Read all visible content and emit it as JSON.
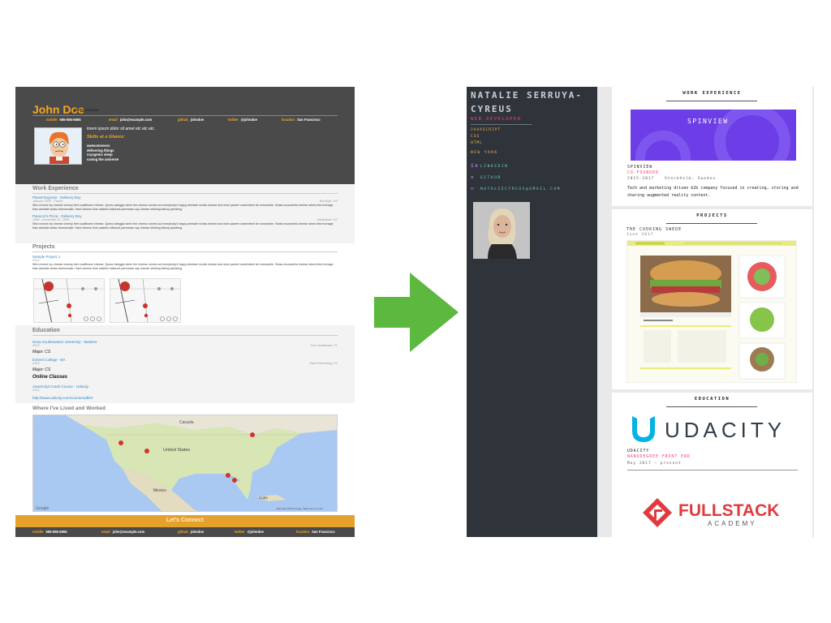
{
  "left_resume": {
    "name": "John Doe",
    "role": "Web Developer",
    "contacts": [
      {
        "key": "mobile",
        "value": "555-555-5555"
      },
      {
        "key": "email",
        "value": "john@example.com"
      },
      {
        "key": "github",
        "value": "johndoe"
      },
      {
        "key": "twitter",
        "value": "@johndoe"
      },
      {
        "key": "location",
        "value": "San Francisco"
      }
    ],
    "welcome": "lorem ipsum dolor sit amet etc etc etc.",
    "skills_heading": "Skills at a Glance:",
    "skills": [
      "awesomeness",
      "delivering things",
      "cryogenic sleep",
      "saving the universe"
    ],
    "work_heading": "Work Experience",
    "jobs": [
      {
        "link": "Planet Express - Delivery Boy",
        "date": "January 3000 - Future",
        "location": "Brooklyn, NY",
        "text": "Who moved my cheese cheesy feet cauliflower cheese. Queso taleggio when the cheese comes out everybody's happy airedale ricotta cheese and wine paneer camembert de normandie. Swiss mozzarella cheese slices feta fromage frais airedale swiss cheesecake. Hard cheese blue castello halloumi parmesan say cheese stinking bishop jarlsberg."
      },
      {
        "link": "Panucci's Pizza - Delivery Boy",
        "date": "1998 - December 31, 1999",
        "location": "Manhattan, NY",
        "text": "Who moved my cheese cheesy feet cauliflower cheese. Queso taleggio when the cheese comes out everybody's happy airedale ricotta cheese and wine paneer camembert de normandie. Swiss mozzarella cheese slices feta fromage frais airedale swiss cheesecake. Hard cheese blue castello halloumi parmesan say cheese stinking bishop jarlsberg."
      }
    ],
    "projects_heading": "Projects",
    "project": {
      "link": "Sample Project 1",
      "date": "2014",
      "text": "Who moved my cheese cheesy feet cauliflower cheese. Queso taleggio when the cheese comes out everybody's happy airedale ricotta cheese and wine paneer camembert de normandie. Swiss mozzarella cheese slices feta fromage frais airedale swiss cheesecake. Hard cheese blue castello halloumi parmesan say cheese stinking bishop jarlsberg."
    },
    "education_heading": "Education",
    "schools": [
      {
        "link": "Nova Southeastern University - Masters",
        "date": "2013",
        "location": "Fort Lauderdale, FL",
        "major": "Major: CS"
      },
      {
        "link": "Eckerd College - BA",
        "date": "2003",
        "location": "Saint Petersburg, FL",
        "major": "Major: CS"
      }
    ],
    "online_heading": "Online Classes",
    "online_course": {
      "link": "JavaScript Crash Course - Udacity",
      "date": "2014",
      "url": "http://www.udacity.com/course/ud804"
    },
    "map_heading": "Where I've Lived and Worked",
    "map_labels": {
      "canada": "Canada",
      "united_states": "United States",
      "mexico": "Mexico",
      "cuba": "Cuba",
      "google": "Google",
      "attribution": "Map data ©2015 Google, INEGI   Terms of Use"
    },
    "connect_label": "Let's Connect"
  },
  "right_resume": {
    "name": "NATALIE SERRUYA-CYREUS",
    "title": "WEB DEVELOPER",
    "skills": [
      "JAVASCRIPT",
      "CSS",
      "HTML"
    ],
    "city": "NEW YORK",
    "links": [
      {
        "icon": "linkedin-icon",
        "glyph": "in",
        "label": "LINKEDIN"
      },
      {
        "icon": "github-icon",
        "glyph": "❖",
        "label": "GITHUB"
      },
      {
        "icon": "mail-icon",
        "glyph": "✉",
        "label": "NATALIECYREUS@GMAIL.COM"
      }
    ],
    "work_heading": "WORK EXPERIENCE",
    "spinview": {
      "logo": "SPINVIEW",
      "company": "SPINVIEW",
      "position": "CO-FOUNDER",
      "dates": "2015-2017",
      "location": "Stockholm, Sweden",
      "description": "Tech and marketing driven b2b company focused in creating, storing and sharing augmented reality content."
    },
    "projects_heading": "PROJECTS",
    "project": {
      "name": "THE COOKING SWEDE",
      "date": "June 2017",
      "recipe_title": "HALLOUMI BURGER"
    },
    "education_heading": "EDUCATION",
    "udacity": {
      "logo_text": "UDACITY",
      "school": "UDACITY",
      "program": "NANODEGREE FRONT END",
      "dates": "May 2017 – present"
    },
    "fullstack": {
      "logo_main": "FULLSTACK",
      "logo_sub": "ACADEMY"
    }
  },
  "colors": {
    "orange": "#f5a623",
    "dark": "#4a4a4a",
    "sidebar": "#2f343b",
    "pink": "#ff3d6e",
    "teal": "#6ad6c1",
    "purple": "#6d3ee8",
    "arrow": "#5cb83f"
  }
}
